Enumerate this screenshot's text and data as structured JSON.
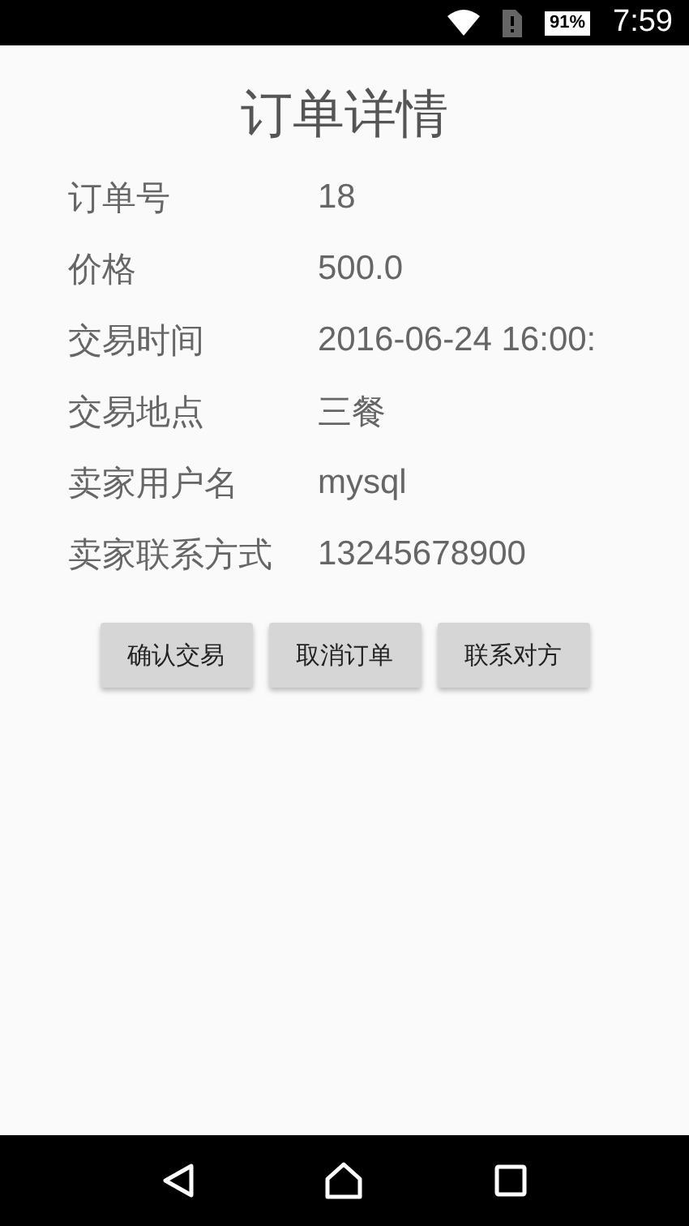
{
  "status_bar": {
    "battery": "91%",
    "time": "7:59"
  },
  "title": "订单详情",
  "fields": [
    {
      "label": "订单号",
      "value": "18"
    },
    {
      "label": "价格",
      "value": "500.0"
    },
    {
      "label": "交易时间",
      "value": "2016-06-24 16:00:"
    },
    {
      "label": "交易地点",
      "value": "三餐"
    },
    {
      "label": "卖家用户名",
      "value": "mysql"
    },
    {
      "label": "卖家联系方式",
      "value": "13245678900"
    }
  ],
  "buttons": [
    "确认交易",
    "取消订单",
    "联系对方"
  ]
}
